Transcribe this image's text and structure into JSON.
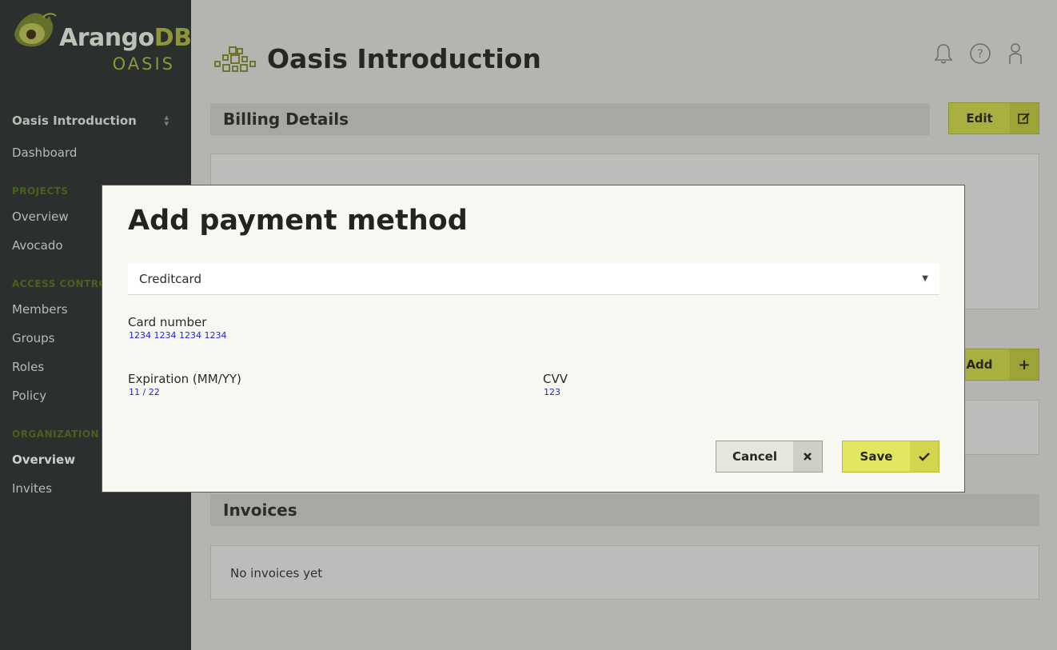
{
  "sidebar": {
    "logo_main": "Arango",
    "logo_db": "DB",
    "logo_sub": "OASIS",
    "project_select": "Oasis Introduction",
    "dashboard": "Dashboard",
    "projects_heading": "PROJECTS",
    "projects": [
      "Overview",
      "Avocado"
    ],
    "access_heading": "ACCESS CONTROL",
    "access": [
      "Members",
      "Groups",
      "Roles",
      "Policy"
    ],
    "org_heading": "ORGANIZATION",
    "org": [
      "Overview",
      "Invites"
    ]
  },
  "header": {
    "title": "Oasis Introduction",
    "icons": [
      "bell-icon",
      "help-icon",
      "user-icon"
    ]
  },
  "billing": {
    "title": "Billing Details",
    "edit_label": "Edit"
  },
  "payment": {
    "add_label": "Add"
  },
  "invoices": {
    "title": "Invoices",
    "empty_text": "No invoices yet"
  },
  "modal": {
    "title": "Add payment method",
    "method": "Creditcard",
    "card_number_label": "Card number",
    "card_number_value": "1234 1234 1234 1234",
    "expiration_label": "Expiration (MM/YY)",
    "expiration_value": "11 / 22",
    "cvv_label": "CVV",
    "cvv_value": "123",
    "cancel_label": "Cancel",
    "save_label": "Save"
  },
  "colors": {
    "sidebar_bg": "#2b2f2d",
    "accent": "#8e953a",
    "save_button": "#e3e660",
    "link_blue": "#1f24d8"
  }
}
